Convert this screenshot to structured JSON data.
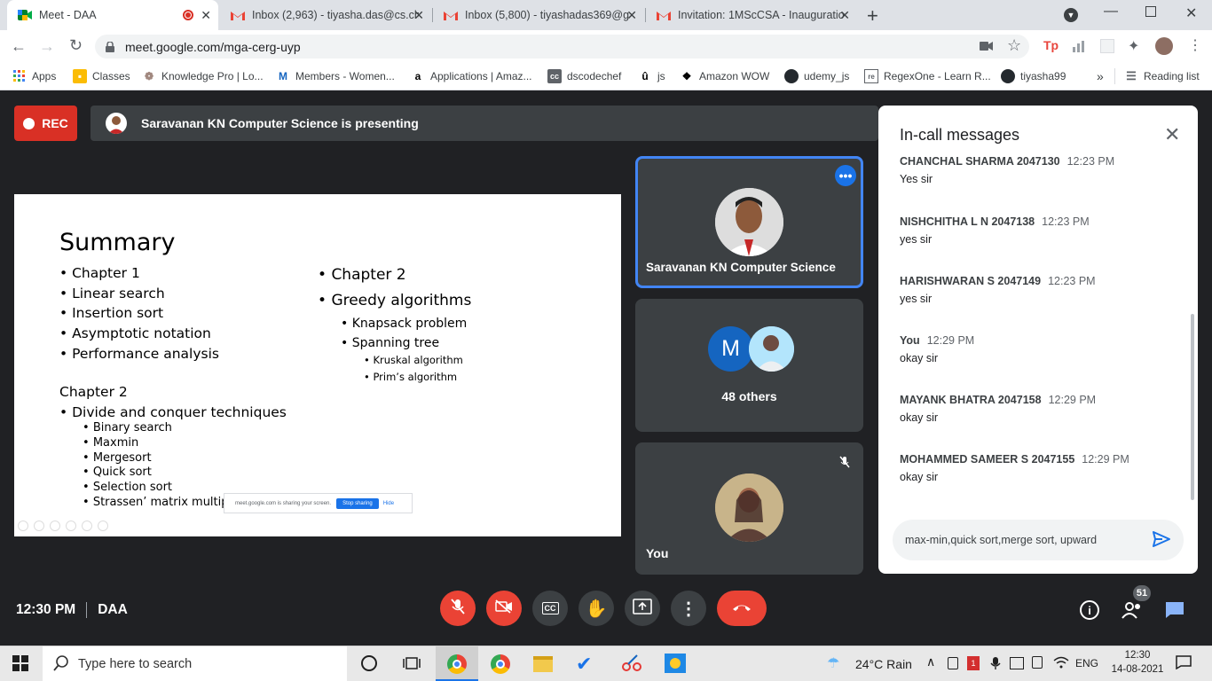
{
  "browser": {
    "tabs": [
      {
        "label": "Meet - DAA",
        "active": true,
        "icon": "meet-icon"
      },
      {
        "label": "Inbox (2,963) - tiyasha.das@cs.ch",
        "icon": "gmail-icon"
      },
      {
        "label": "Inbox (5,800) - tiyashadas369@g",
        "icon": "gmail-icon"
      },
      {
        "label": "Invitation: 1MScCSA - Inauguratio",
        "icon": "gmail-icon"
      }
    ],
    "url": "meet.google.com/mga-cerg-uyp",
    "bookmarks": [
      {
        "label": "Apps"
      },
      {
        "label": "Classes"
      },
      {
        "label": "Knowledge Pro | Lo..."
      },
      {
        "label": "Members - Women..."
      },
      {
        "label": "Applications | Amaz..."
      },
      {
        "label": "dscodechef"
      },
      {
        "label": "js"
      },
      {
        "label": "Amazon WOW"
      },
      {
        "label": "udemy_js"
      },
      {
        "label": "RegexOne - Learn R..."
      },
      {
        "label": "tiyasha99"
      }
    ],
    "more_bookmarks": "»",
    "reading_list": "Reading list"
  },
  "meet": {
    "rec_label": "REC",
    "presenting_text": "Saravanan KN Computer Science is presenting",
    "tiles": {
      "presenter_name": "Saravanan KN Computer Science",
      "others_initial": "M",
      "others_label": "48 others",
      "self_label": "You"
    },
    "slide": {
      "title": "Summary",
      "left_items": [
        "Chapter 1",
        "Linear search",
        "Insertion sort",
        "Asymptotic notation",
        "Performance analysis"
      ],
      "chapter2_heading": "Chapter 2",
      "chapter2_item": "Divide and conquer techniques",
      "chapter2_sub": [
        "Binary search",
        "Maxmin",
        "Mergesort",
        "Quick sort",
        "Selection sort",
        "Strassen’ matrix multip"
      ],
      "right_items": [
        "Chapter 2",
        "Greedy algorithms"
      ],
      "right_sub": [
        "Knapsack problem",
        "Spanning tree"
      ],
      "right_subsub": [
        "Kruskal algorithm",
        "Prim’s algorithm"
      ],
      "share_bar_text": "meet.google.com is sharing your screen.",
      "stop_sharing": "Stop sharing",
      "hide": "Hide"
    },
    "chat": {
      "title": "In-call messages",
      "messages": [
        {
          "sender": "CHANCHAL SHARMA 2047130",
          "time": "12:23 PM",
          "text": "Yes sir"
        },
        {
          "sender": "NISHCHITHA L N 2047138",
          "time": "12:23 PM",
          "text": "yes sir"
        },
        {
          "sender": "HARISHWARAN S 2047149",
          "time": "12:23 PM",
          "text": "yes sir"
        },
        {
          "sender": "You",
          "time": "12:29 PM",
          "text": "okay sir"
        },
        {
          "sender": "MAYANK BHATRA 2047158",
          "time": "12:29 PM",
          "text": "okay sir"
        },
        {
          "sender": "MOHAMMED SAMEER S 2047155",
          "time": "12:29 PM",
          "text": "okay sir"
        }
      ],
      "input_value": "max-min,quick sort,merge sort, upward"
    },
    "bottom": {
      "time": "12:30 PM",
      "meeting_name": "DAA",
      "participants_count": "51"
    }
  },
  "taskbar": {
    "search_placeholder": "Type here to search",
    "weather": "24°C  Rain",
    "language": "ENG",
    "clock_time": "12:30",
    "clock_date": "14-08-2021"
  },
  "colors": {
    "red": "#ea4335",
    "accent_blue": "#1a73e8",
    "meet_bg": "#202124",
    "tile_bg": "#3c4043"
  }
}
